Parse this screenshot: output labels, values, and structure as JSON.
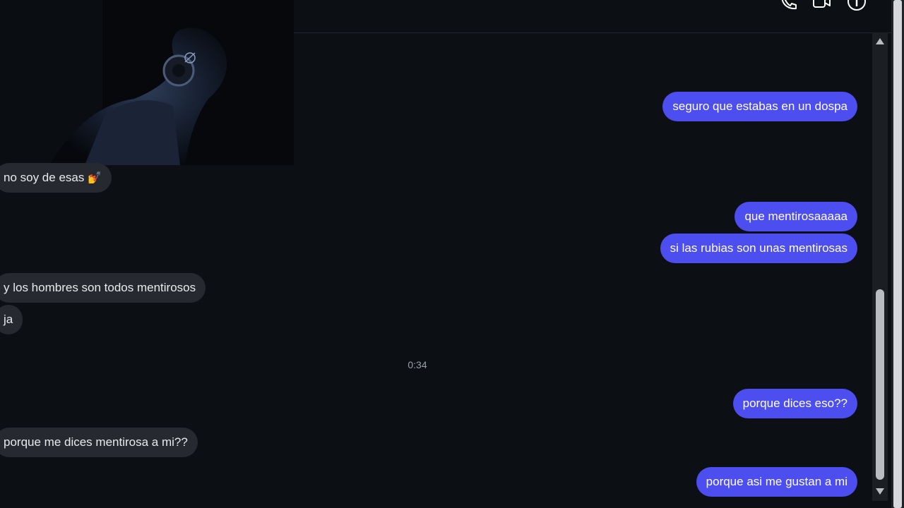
{
  "header": {
    "icons": [
      "phone-icon",
      "video-icon",
      "info-icon"
    ]
  },
  "messages": [
    {
      "id": "m1",
      "direction": "out",
      "text": "seguro que estabas en un dospa"
    },
    {
      "id": "m2",
      "direction": "in",
      "text": "no soy de esas",
      "emoji": "💅"
    },
    {
      "id": "m3",
      "direction": "out",
      "text": "que mentirosaaaaa"
    },
    {
      "id": "m4",
      "direction": "out",
      "text": "si las rubias son unas mentirosas"
    },
    {
      "id": "m5",
      "direction": "in",
      "text": "y los hombres son todos mentirosos"
    },
    {
      "id": "m6",
      "direction": "in",
      "text": "ja"
    },
    {
      "id": "m7",
      "direction": "out",
      "text": "porque dices eso??"
    },
    {
      "id": "m8",
      "direction": "in",
      "text": "porque me dices mentirosa a mi??"
    },
    {
      "id": "m9",
      "direction": "out",
      "text": "porque asi me gustan a mi"
    }
  ],
  "timestamp": "0:34",
  "colors": {
    "background": "#0c0f14",
    "outgoing_bubble": "#4c4ef0",
    "incoming_bubble": "#26292f",
    "outgoing_text": "#ffffff",
    "incoming_text": "#e9eaec",
    "timestamp_text": "#9aa0a8"
  }
}
